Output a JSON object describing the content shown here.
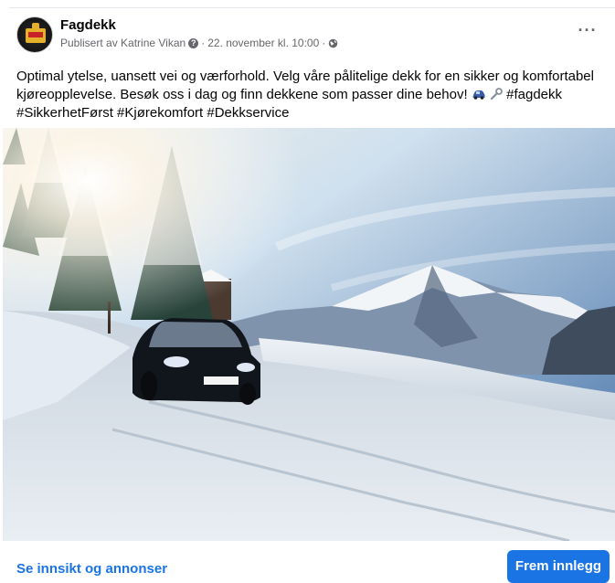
{
  "post": {
    "page_name": "Fagdekk",
    "published_by": "Publisert av Katrine Vikan",
    "separator": "·",
    "date": "22. november kl. 10:00",
    "more_icon": "more-options-icon",
    "text_line1": "Optimal ytelse, uansett vei og værforhold. Velg våre pålitelige dekk for en sikker og komfortabel",
    "text_line2_before": "kjøreopplevelse. Besøk oss i dag og finn dekkene som passer dine behov!",
    "hashtag_fagdekk": "#fagdekk",
    "hashtags_line3": "#SikkerhetFørst #Kjørekomfort #Dekkservice",
    "emojis": [
      "car-emoji",
      "wrench-emoji"
    ],
    "image_description_icon": "post-photo-image"
  },
  "footer": {
    "insights_link": "Se innsikt og annonser",
    "boost_button": "Frem innlegg"
  },
  "colors": {
    "link_blue": "#1b74e4",
    "meta_gray": "#65676b",
    "text": "#050505"
  }
}
